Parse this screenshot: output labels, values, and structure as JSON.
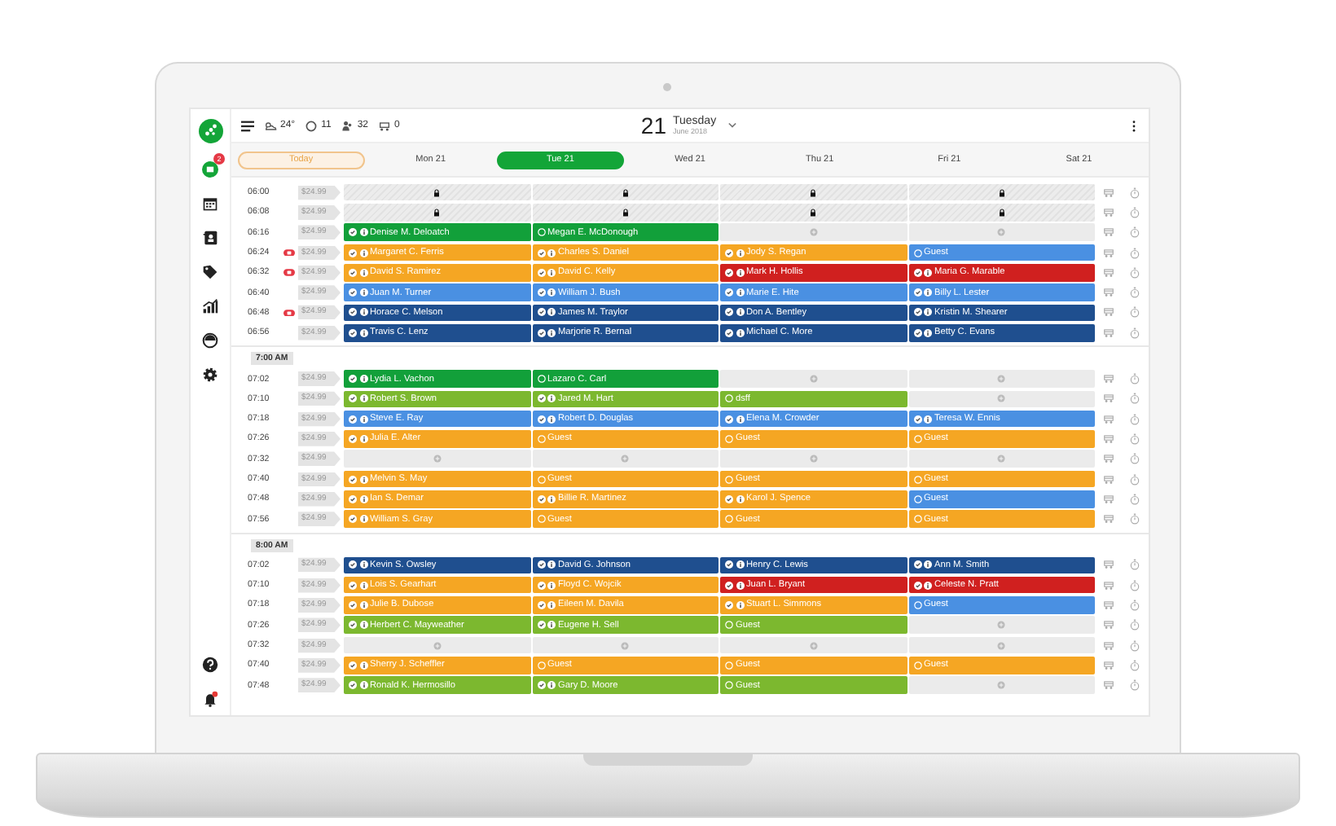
{
  "header": {
    "stats": [
      {
        "kind": "weather",
        "value": "24°"
      },
      {
        "kind": "circle",
        "value": "11"
      },
      {
        "kind": "people",
        "value": "32"
      },
      {
        "kind": "cart",
        "value": "0"
      }
    ],
    "date": {
      "day": "21",
      "weekday": "Tuesday",
      "month": "June 2018"
    }
  },
  "sidebar": {
    "badge": "2",
    "bell_alert": true
  },
  "tabs": [
    {
      "label": "Today",
      "kind": "today",
      "selected": false
    },
    {
      "label": "Mon 21",
      "kind": "day",
      "selected": false
    },
    {
      "label": "Tue 21",
      "kind": "day",
      "selected": true
    },
    {
      "label": "Wed 21",
      "kind": "day",
      "selected": false
    },
    {
      "label": "Thu 21",
      "kind": "day",
      "selected": false
    },
    {
      "label": "Fri 21",
      "kind": "day",
      "selected": false
    },
    {
      "label": "Sat 21",
      "kind": "day",
      "selected": false
    }
  ],
  "groups": [
    {
      "rows": [
        {
          "time": "06:00",
          "alert": false,
          "price": "$24.99",
          "slots": [
            {
              "kind": "locked"
            },
            {
              "kind": "locked"
            },
            {
              "kind": "locked"
            },
            {
              "kind": "locked"
            }
          ]
        },
        {
          "time": "06:08",
          "alert": false,
          "price": "$24.99",
          "slots": [
            {
              "kind": "locked"
            },
            {
              "kind": "locked"
            },
            {
              "kind": "locked"
            },
            {
              "kind": "locked"
            }
          ]
        },
        {
          "time": "06:16",
          "alert": false,
          "price": "$24.99",
          "slots": [
            {
              "kind": "booking",
              "name": "Denise M. Deloatch",
              "color": "#12a03a",
              "confirmed": true
            },
            {
              "kind": "booking",
              "name": "Megan E. McDonough",
              "color": "#12a03a",
              "confirmed": false
            },
            {
              "kind": "empty"
            },
            {
              "kind": "empty"
            }
          ]
        },
        {
          "time": "06:24",
          "alert": true,
          "price": "$24.99",
          "slots": [
            {
              "kind": "booking",
              "name": "Margaret C. Ferris",
              "color": "#f5a623",
              "confirmed": true
            },
            {
              "kind": "booking",
              "name": "Charles S. Daniel",
              "color": "#f5a623",
              "confirmed": true
            },
            {
              "kind": "booking",
              "name": "Jody S. Regan",
              "color": "#f5a623",
              "confirmed": true
            },
            {
              "kind": "booking",
              "name": "Guest",
              "color": "#4a90e2",
              "confirmed": false
            }
          ]
        },
        {
          "time": "06:32",
          "alert": true,
          "price": "$24.99",
          "slots": [
            {
              "kind": "booking",
              "name": "David S. Ramirez",
              "color": "#f5a623",
              "confirmed": true
            },
            {
              "kind": "booking",
              "name": "David C. Kelly",
              "color": "#f5a623",
              "confirmed": true
            },
            {
              "kind": "booking",
              "name": "Mark H. Hollis",
              "color": "#d0201f",
              "confirmed": true
            },
            {
              "kind": "booking",
              "name": "Maria G. Marable",
              "color": "#d0201f",
              "confirmed": true
            }
          ]
        },
        {
          "time": "06:40",
          "alert": false,
          "price": "$24.99",
          "slots": [
            {
              "kind": "booking",
              "name": "Juan M. Turner",
              "color": "#4a90e2",
              "confirmed": true
            },
            {
              "kind": "booking",
              "name": "William J. Bush",
              "color": "#4a90e2",
              "confirmed": true
            },
            {
              "kind": "booking",
              "name": "Marie E. Hite",
              "color": "#4a90e2",
              "confirmed": true
            },
            {
              "kind": "booking",
              "name": "Billy L. Lester",
              "color": "#4a90e2",
              "confirmed": true
            }
          ]
        },
        {
          "time": "06:48",
          "alert": true,
          "price": "$24.99",
          "slots": [
            {
              "kind": "booking",
              "name": "Horace C. Melson",
              "color": "#1f4f8f",
              "confirmed": true
            },
            {
              "kind": "booking",
              "name": "James M. Traylor",
              "color": "#1f4f8f",
              "confirmed": true
            },
            {
              "kind": "booking",
              "name": "Don A. Bentley",
              "color": "#1f4f8f",
              "confirmed": true
            },
            {
              "kind": "booking",
              "name": "Kristin M. Shearer",
              "color": "#1f4f8f",
              "confirmed": true
            }
          ]
        },
        {
          "time": "06:56",
          "alert": false,
          "price": "$24.99",
          "slots": [
            {
              "kind": "booking",
              "name": "Travis C. Lenz",
              "color": "#1f4f8f",
              "confirmed": true
            },
            {
              "kind": "booking",
              "name": "Marjorie R. Bernal",
              "color": "#1f4f8f",
              "confirmed": true
            },
            {
              "kind": "booking",
              "name": "Michael C. More",
              "color": "#1f4f8f",
              "confirmed": true
            },
            {
              "kind": "booking",
              "name": "Betty C. Evans",
              "color": "#1f4f8f",
              "confirmed": true
            }
          ]
        }
      ]
    },
    {
      "label": "7:00 AM",
      "rows": [
        {
          "time": "07:02",
          "alert": false,
          "price": "$24.99",
          "slots": [
            {
              "kind": "booking",
              "name": "Lydia L. Vachon",
              "color": "#12a03a",
              "confirmed": true
            },
            {
              "kind": "booking",
              "name": "Lazaro C. Carl",
              "color": "#12a03a",
              "confirmed": false
            },
            {
              "kind": "empty"
            },
            {
              "kind": "empty"
            }
          ]
        },
        {
          "time": "07:10",
          "alert": false,
          "price": "$24.99",
          "slots": [
            {
              "kind": "booking",
              "name": "Robert S. Brown",
              "color": "#7cb82f",
              "confirmed": true
            },
            {
              "kind": "booking",
              "name": "Jared M. Hart",
              "color": "#7cb82f",
              "confirmed": true
            },
            {
              "kind": "booking",
              "name": "dsff",
              "color": "#7cb82f",
              "confirmed": false
            },
            {
              "kind": "empty"
            }
          ]
        },
        {
          "time": "07:18",
          "alert": false,
          "price": "$24.99",
          "slots": [
            {
              "kind": "booking",
              "name": "Steve E. Ray",
              "color": "#4a90e2",
              "confirmed": true
            },
            {
              "kind": "booking",
              "name": "Robert D. Douglas",
              "color": "#4a90e2",
              "confirmed": true
            },
            {
              "kind": "booking",
              "name": "Elena M. Crowder",
              "color": "#4a90e2",
              "confirmed": true
            },
            {
              "kind": "booking",
              "name": "Teresa W. Ennis",
              "color": "#4a90e2",
              "confirmed": true
            }
          ]
        },
        {
          "time": "07:26",
          "alert": false,
          "price": "$24.99",
          "slots": [
            {
              "kind": "booking",
              "name": "Julia E. Alter",
              "color": "#f5a623",
              "confirmed": true
            },
            {
              "kind": "booking",
              "name": "Guest",
              "color": "#f5a623",
              "confirmed": false
            },
            {
              "kind": "booking",
              "name": "Guest",
              "color": "#f5a623",
              "confirmed": false
            },
            {
              "kind": "booking",
              "name": "Guest",
              "color": "#f5a623",
              "confirmed": false
            }
          ]
        },
        {
          "time": "07:32",
          "alert": false,
          "price": "$24.99",
          "slots": [
            {
              "kind": "empty"
            },
            {
              "kind": "empty"
            },
            {
              "kind": "empty"
            },
            {
              "kind": "empty"
            }
          ]
        },
        {
          "time": "07:40",
          "alert": false,
          "price": "$24.99",
          "slots": [
            {
              "kind": "booking",
              "name": "Melvin S. May",
              "color": "#f5a623",
              "confirmed": true
            },
            {
              "kind": "booking",
              "name": "Guest",
              "color": "#f5a623",
              "confirmed": false
            },
            {
              "kind": "booking",
              "name": "Guest",
              "color": "#f5a623",
              "confirmed": false
            },
            {
              "kind": "booking",
              "name": "Guest",
              "color": "#f5a623",
              "confirmed": false
            }
          ]
        },
        {
          "time": "07:48",
          "alert": false,
          "price": "$24.99",
          "slots": [
            {
              "kind": "booking",
              "name": "Ian S. Demar",
              "color": "#f5a623",
              "confirmed": true
            },
            {
              "kind": "booking",
              "name": "Billie R. Martinez",
              "color": "#f5a623",
              "confirmed": true
            },
            {
              "kind": "booking",
              "name": "Karol J. Spence",
              "color": "#f5a623",
              "confirmed": true
            },
            {
              "kind": "booking",
              "name": "Guest",
              "color": "#4a90e2",
              "confirmed": false
            }
          ]
        },
        {
          "time": "07:56",
          "alert": false,
          "price": "$24.99",
          "slots": [
            {
              "kind": "booking",
              "name": "William S. Gray",
              "color": "#f5a623",
              "confirmed": true
            },
            {
              "kind": "booking",
              "name": "Guest",
              "color": "#f5a623",
              "confirmed": false
            },
            {
              "kind": "booking",
              "name": "Guest",
              "color": "#f5a623",
              "confirmed": false
            },
            {
              "kind": "booking",
              "name": "Guest",
              "color": "#f5a623",
              "confirmed": false
            }
          ]
        }
      ]
    },
    {
      "label": "8:00 AM",
      "rows": [
        {
          "time": "07:02",
          "alert": false,
          "price": "$24.99",
          "slots": [
            {
              "kind": "booking",
              "name": "Kevin S. Owsley",
              "color": "#1f4f8f",
              "confirmed": true
            },
            {
              "kind": "booking",
              "name": "David G. Johnson",
              "color": "#1f4f8f",
              "confirmed": true
            },
            {
              "kind": "booking",
              "name": "Henry C. Lewis",
              "color": "#1f4f8f",
              "confirmed": true
            },
            {
              "kind": "booking",
              "name": "Ann M. Smith",
              "color": "#1f4f8f",
              "confirmed": true
            }
          ]
        },
        {
          "time": "07:10",
          "alert": false,
          "price": "$24.99",
          "slots": [
            {
              "kind": "booking",
              "name": "Lois S. Gearhart",
              "color": "#f5a623",
              "confirmed": true
            },
            {
              "kind": "booking",
              "name": "Floyd C. Wojcik",
              "color": "#f5a623",
              "confirmed": true
            },
            {
              "kind": "booking",
              "name": "Juan L. Bryant",
              "color": "#d0201f",
              "confirmed": true
            },
            {
              "kind": "booking",
              "name": "Celeste N. Pratt",
              "color": "#d0201f",
              "confirmed": true
            }
          ]
        },
        {
          "time": "07:18",
          "alert": false,
          "price": "$24.99",
          "slots": [
            {
              "kind": "booking",
              "name": "Julie B. Dubose",
              "color": "#f5a623",
              "confirmed": true
            },
            {
              "kind": "booking",
              "name": "Eileen M. Davila",
              "color": "#f5a623",
              "confirmed": true
            },
            {
              "kind": "booking",
              "name": "Stuart L. Simmons",
              "color": "#f5a623",
              "confirmed": true
            },
            {
              "kind": "booking",
              "name": "Guest",
              "color": "#4a90e2",
              "confirmed": false
            }
          ]
        },
        {
          "time": "07:26",
          "alert": false,
          "price": "$24.99",
          "slots": [
            {
              "kind": "booking",
              "name": "Herbert C. Mayweather",
              "color": "#7cb82f",
              "confirmed": true
            },
            {
              "kind": "booking",
              "name": "Eugene H. Sell",
              "color": "#7cb82f",
              "confirmed": true
            },
            {
              "kind": "booking",
              "name": "Guest",
              "color": "#7cb82f",
              "confirmed": false
            },
            {
              "kind": "empty"
            }
          ]
        },
        {
          "time": "07:32",
          "alert": false,
          "price": "$24.99",
          "slots": [
            {
              "kind": "empty"
            },
            {
              "kind": "empty"
            },
            {
              "kind": "empty"
            },
            {
              "kind": "empty"
            }
          ]
        },
        {
          "time": "07:40",
          "alert": false,
          "price": "$24.99",
          "slots": [
            {
              "kind": "booking",
              "name": "Sherry J. Scheffler",
              "color": "#f5a623",
              "confirmed": true
            },
            {
              "kind": "booking",
              "name": "Guest",
              "color": "#f5a623",
              "confirmed": false
            },
            {
              "kind": "booking",
              "name": "Guest",
              "color": "#f5a623",
              "confirmed": false
            },
            {
              "kind": "booking",
              "name": "Guest",
              "color": "#f5a623",
              "confirmed": false
            }
          ]
        },
        {
          "time": "07:48",
          "alert": false,
          "price": "$24.99",
          "slots": [
            {
              "kind": "booking",
              "name": "Ronald K. Hermosillo",
              "color": "#7cb82f",
              "confirmed": true
            },
            {
              "kind": "booking",
              "name": "Gary D. Moore",
              "color": "#7cb82f",
              "confirmed": true
            },
            {
              "kind": "booking",
              "name": "Guest",
              "color": "#7cb82f",
              "confirmed": false
            },
            {
              "kind": "empty"
            }
          ]
        }
      ]
    }
  ]
}
